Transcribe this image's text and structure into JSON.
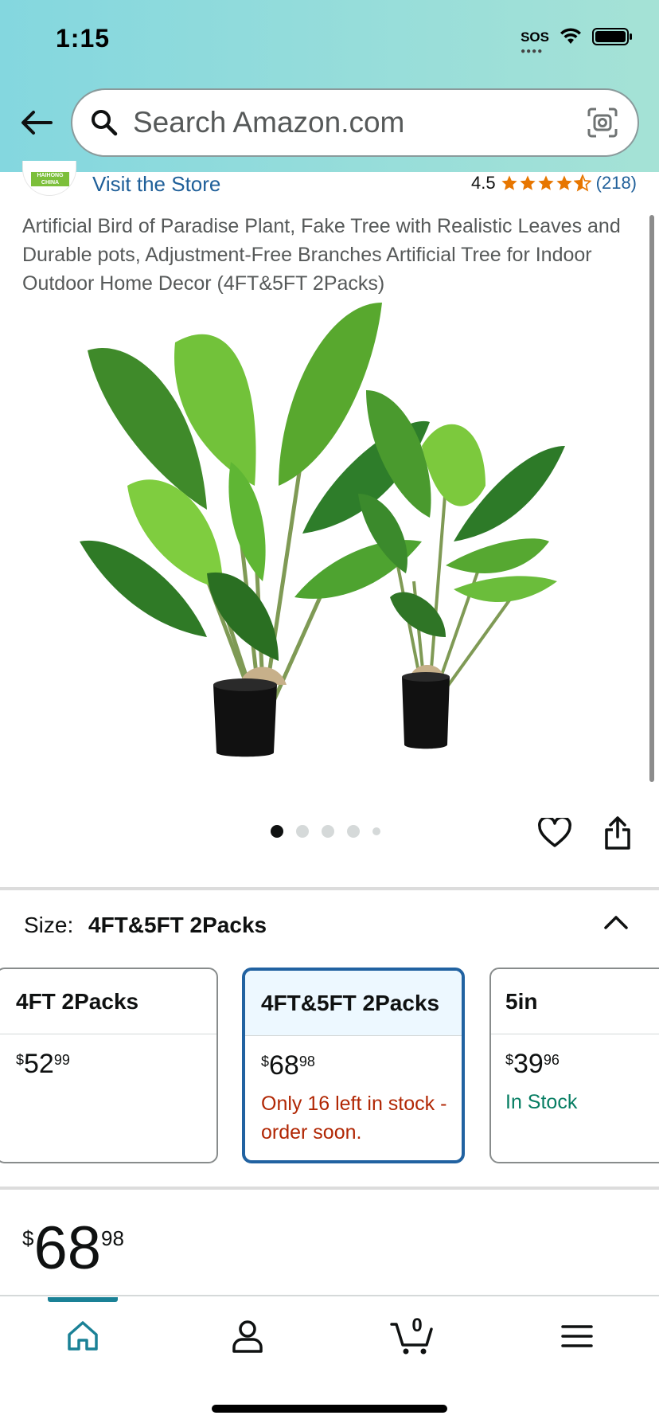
{
  "status_bar": {
    "time": "1:15",
    "sos": "SOS"
  },
  "search": {
    "placeholder": "Search Amazon.com"
  },
  "store": {
    "logo_text": "HAIHONG CHINA ENTERPRISE",
    "visit_label": "Visit the Store"
  },
  "rating": {
    "value": "4.5",
    "stars": 4.5,
    "count": "(218)"
  },
  "product": {
    "title": "Artificial Bird of Paradise Plant, Fake Tree with Realistic Leaves and Durable pots, Adjustment-Free Branches Artificial Tree for Indoor Outdoor Home Decor (4FT&5FT 2Packs)"
  },
  "carousel": {
    "total": 5,
    "active_index": 0
  },
  "size": {
    "label": "Size:",
    "selected": "4FT&5FT 2Packs",
    "options": [
      {
        "name": "4FT 2Packs",
        "dollar": "$",
        "whole": "52",
        "cents": "99",
        "status": ""
      },
      {
        "name": "4FT&5FT 2Packs",
        "dollar": "$",
        "whole": "68",
        "cents": "98",
        "status": "Only 16 left in stock - order soon."
      },
      {
        "name": "5in",
        "dollar": "$",
        "whole": "39",
        "cents": "96",
        "status": "In Stock"
      }
    ]
  },
  "price": {
    "dollar": "$",
    "whole": "68",
    "cents": "98"
  },
  "nav": {
    "cart_count": "0",
    "items": [
      "home-icon",
      "account-icon",
      "cart-icon",
      "menu-icon"
    ]
  },
  "colors": {
    "accent": "#1a8196",
    "link": "#1f5f99",
    "star": "#e77600",
    "selected_border": "#2162a1",
    "low_stock": "#b12704",
    "in_stock": "#067d62"
  }
}
